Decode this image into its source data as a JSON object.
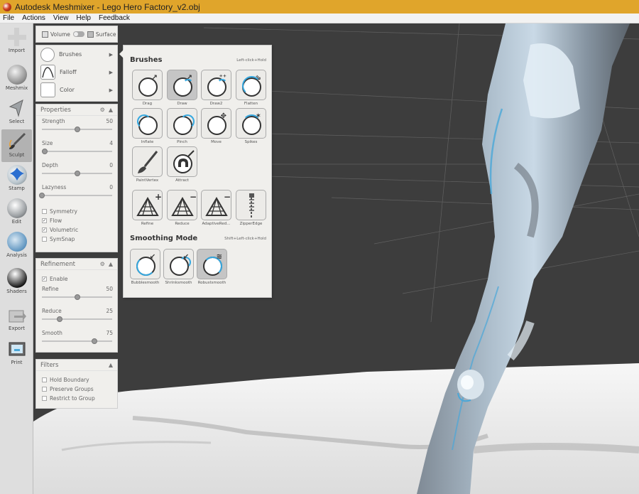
{
  "window": {
    "title": "Autodesk Meshmixer - Lego Hero Factory_v2.obj"
  },
  "menu": [
    "File",
    "Actions",
    "View",
    "Help",
    "Feedback"
  ],
  "tools": [
    {
      "label": "Import",
      "name": "import"
    },
    {
      "label": "Meshmix",
      "name": "meshmix"
    },
    {
      "label": "Select",
      "name": "select"
    },
    {
      "label": "Sculpt",
      "name": "sculpt",
      "active": true
    },
    {
      "label": "Stamp",
      "name": "stamp"
    },
    {
      "label": "Edit",
      "name": "edit"
    },
    {
      "label": "Analysis",
      "name": "analysis"
    },
    {
      "label": "Shaders",
      "name": "shaders"
    },
    {
      "label": "Export",
      "name": "export"
    },
    {
      "label": "Print",
      "name": "print"
    }
  ],
  "mode_toggle": {
    "volume": "Volume",
    "surface": "Surface"
  },
  "brush_panel": {
    "brushes": "Brushes",
    "falloff": "Falloff",
    "color": "Color"
  },
  "properties": {
    "title": "Properties",
    "sliders": [
      {
        "label": "Strength",
        "value": "50",
        "pos": 0.5
      },
      {
        "label": "Size",
        "value": "4",
        "pos": 0.04
      },
      {
        "label": "Depth",
        "value": "0",
        "pos": 0.5
      },
      {
        "label": "Lazyness",
        "value": "0",
        "pos": 0.0
      }
    ],
    "checks": [
      {
        "label": "Symmetry",
        "checked": false
      },
      {
        "label": "Flow",
        "checked": true
      },
      {
        "label": "Volumetric",
        "checked": true
      },
      {
        "label": "SymSnap",
        "checked": false
      }
    ]
  },
  "refinement": {
    "title": "Refinement",
    "enable": {
      "label": "Enable",
      "checked": true
    },
    "sliders": [
      {
        "label": "Refine",
        "value": "50",
        "pos": 0.5
      },
      {
        "label": "Reduce",
        "value": "25",
        "pos": 0.25
      },
      {
        "label": "Smooth",
        "value": "75",
        "pos": 0.75
      }
    ]
  },
  "filters": {
    "title": "Filters",
    "checks": [
      {
        "label": "Hold Boundary",
        "checked": false
      },
      {
        "label": "Preserve Groups",
        "checked": false
      },
      {
        "label": "Restrict to Group",
        "checked": false
      }
    ]
  },
  "popup": {
    "title": "Brushes",
    "hint": "Left-click+Hold",
    "brushes": [
      "Drag",
      "Draw",
      "Draw2",
      "Flatten",
      "Inflate",
      "Pinch",
      "Move",
      "Spikes",
      "PaintVertex",
      "Attract"
    ],
    "topology": [
      "Refine",
      "Reduce",
      "AdaptiveRed...",
      "ZipperEdge"
    ],
    "smoothing_title": "Smoothing Mode",
    "smoothing_hint": "Shift+Left-click+Hold",
    "smoothing": [
      "Bubblesmooth",
      "Shrinksmooth",
      "Robustsmooth"
    ]
  },
  "colors": {
    "titlebar": "#e0a52b",
    "accent_blue": "#35a8e0",
    "panel": "#f0efec"
  }
}
